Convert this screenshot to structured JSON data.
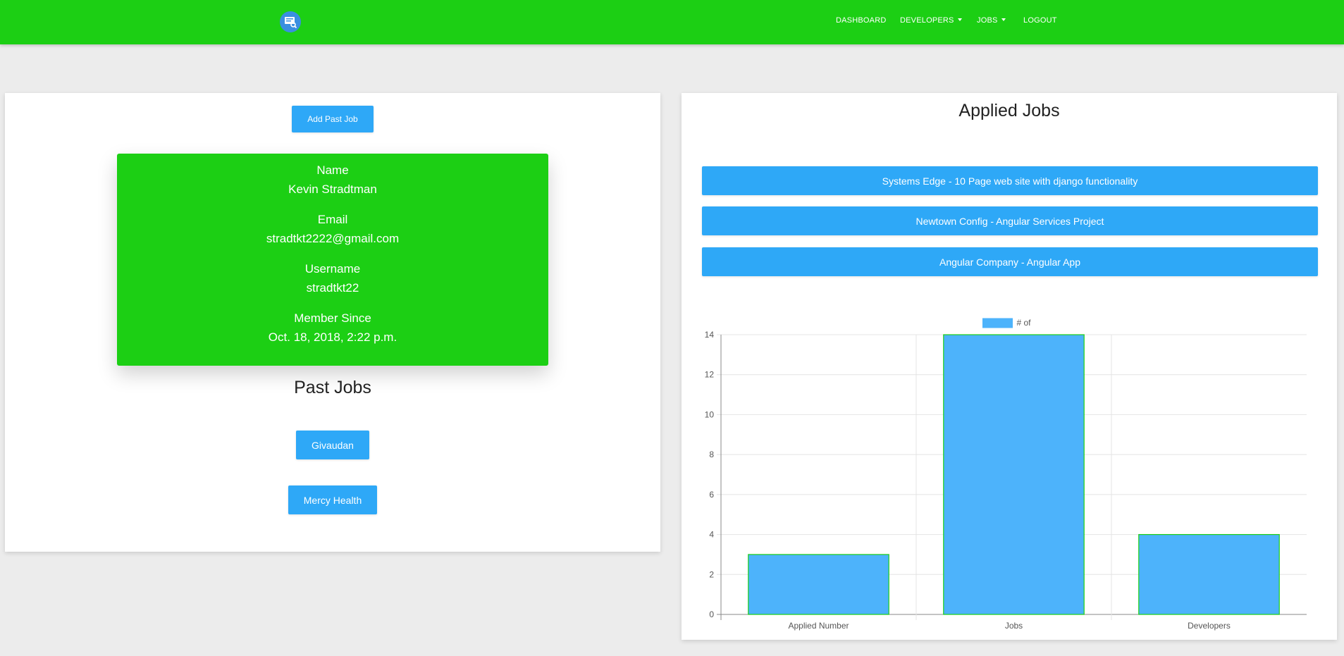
{
  "nav": {
    "items": [
      {
        "label": "DASHBOARD",
        "dropdown": false
      },
      {
        "label": "DEVELOPERS",
        "dropdown": true
      },
      {
        "label": "JOBS",
        "dropdown": true
      },
      {
        "label": "LOGOUT",
        "dropdown": false
      }
    ],
    "logo_icon": "monitor-search-icon",
    "color": "#1ccf14"
  },
  "left": {
    "add_button": "Add Past Job",
    "profile": {
      "name_label": "Name",
      "name_value": "Kevin Stradtman",
      "email_label": "Email",
      "email_value": "stradtkt2222@gmail.com",
      "username_label": "Username",
      "username_value": "stradtkt22",
      "member_label": "Member Since",
      "member_value": "Oct. 18, 2018, 2:22 p.m."
    },
    "past_jobs_title": "Past Jobs",
    "past_jobs": [
      "Givaudan",
      "Mercy Health"
    ]
  },
  "right": {
    "title": "Applied Jobs",
    "jobs": [
      "Systems Edge - 10 Page web site with django functionality",
      "Newtown Config - Angular Services Project",
      "Angular Company - Angular App"
    ]
  },
  "chart_data": {
    "type": "bar",
    "categories": [
      "Applied Number",
      "Jobs",
      "Developers"
    ],
    "series": [
      {
        "name": "# of",
        "values": [
          3,
          14,
          4
        ]
      }
    ],
    "ylim": [
      0,
      14
    ],
    "yticks": [
      0,
      2,
      4,
      6,
      8,
      10,
      12,
      14
    ],
    "grid": true,
    "legend": "top-center",
    "colors": {
      "fill": "#4db3fb",
      "border": "#1ccf14"
    }
  }
}
